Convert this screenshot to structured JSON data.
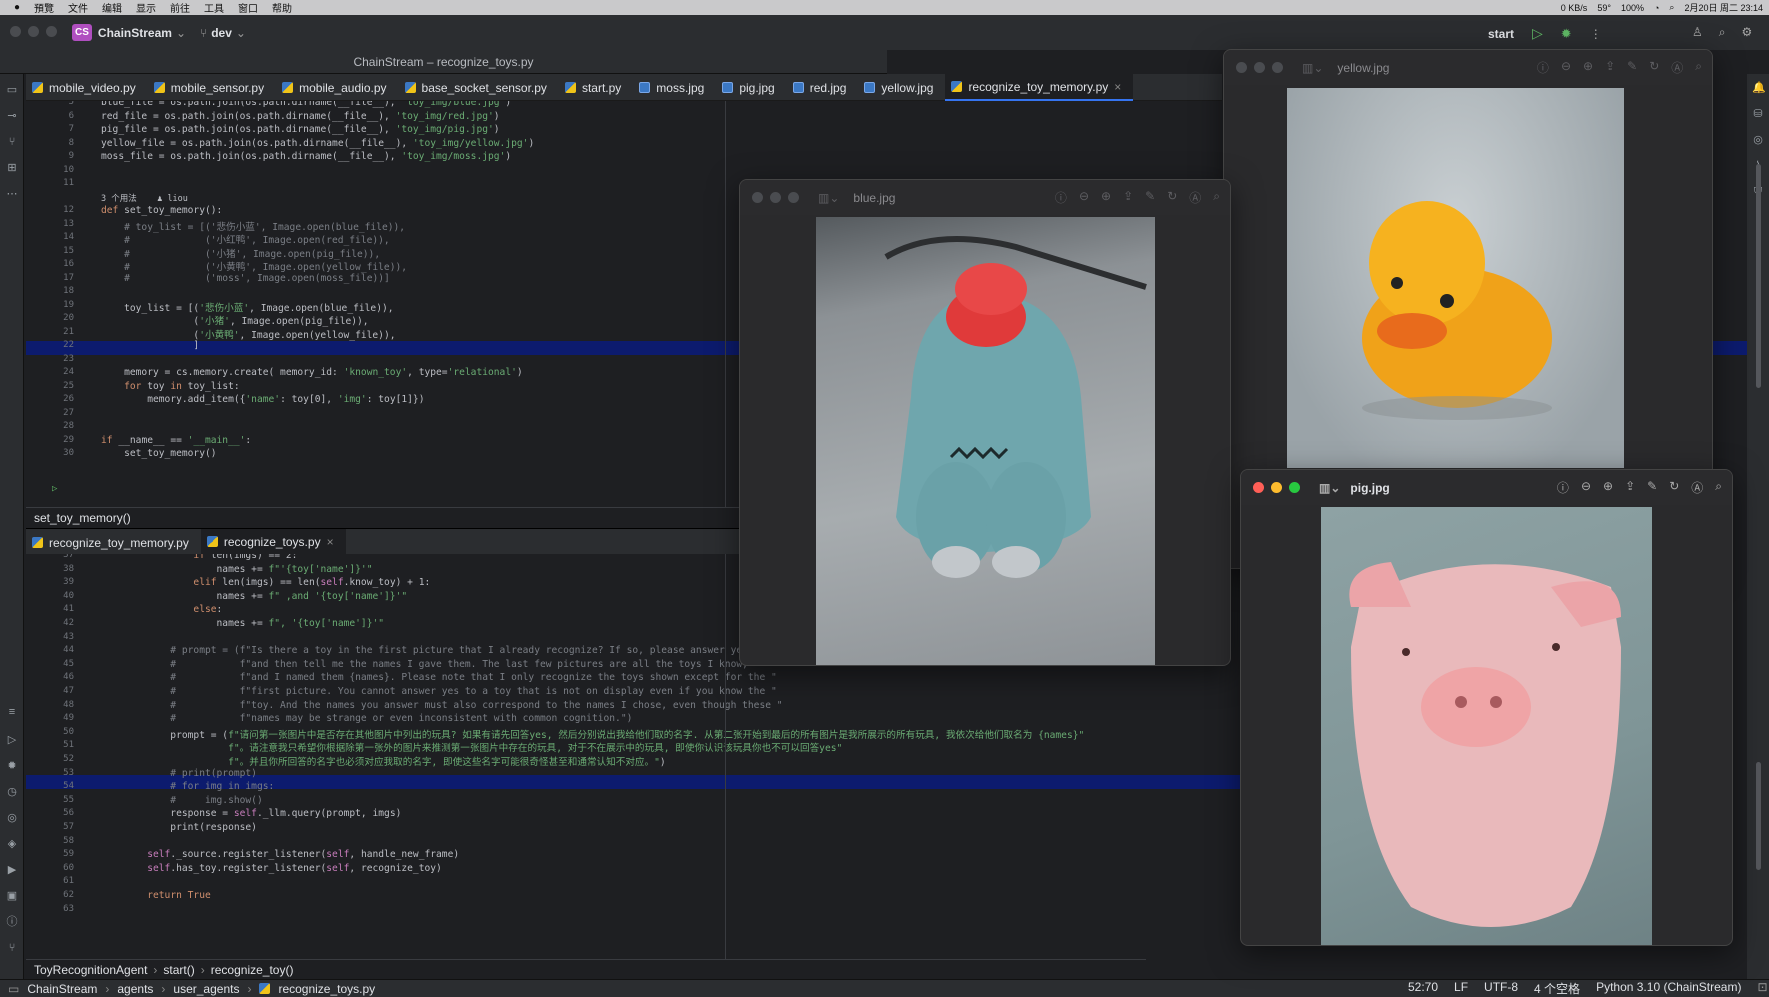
{
  "menubar": {
    "items": [
      "預覽",
      "文件",
      "编辑",
      "显示",
      "前往",
      "工具",
      "窗口",
      "帮助"
    ],
    "status": "100%",
    "temp": "59°",
    "datetime": "2月20日 周二 23:14",
    "net": "0 KB/s"
  },
  "toolbar": {
    "project": "ChainStream",
    "project_badge": "CS",
    "branch": "dev",
    "run_config": "start"
  },
  "window_title": "ChainStream – recognize_toys.py",
  "tabs": [
    "mobile_video.py",
    "mobile_sensor.py",
    "mobile_audio.py",
    "base_socket_sensor.py",
    "start.py",
    "moss.jpg",
    "pig.jpg",
    "red.jpg",
    "yellow.jpg",
    "recognize_toy_memory.py"
  ],
  "tab_types": [
    "py",
    "py",
    "py",
    "py",
    "py",
    "img",
    "img",
    "img",
    "img",
    "py"
  ],
  "editor1": {
    "line_numbers": [
      "5",
      "6",
      "7",
      "8",
      "9",
      "10",
      "11",
      "",
      "12",
      "13",
      "14",
      "15",
      "16",
      "17",
      "18",
      "19",
      "20",
      "21",
      "22",
      "23",
      "24",
      "25",
      "26",
      "27",
      "28",
      "29",
      "30"
    ],
    "usage_hint": "3 个用法    ♟ liou",
    "lines": [
      "blue_file = os.path.join(os.path.dirname(__file__), 'toy_img/blue.jpg')",
      "red_file = os.path.join(os.path.dirname(__file__), 'toy_img/red.jpg')",
      "pig_file = os.path.join(os.path.dirname(__file__), 'toy_img/pig.jpg')",
      "yellow_file = os.path.join(os.path.dirname(__file__), 'toy_img/yellow.jpg')",
      "moss_file = os.path.join(os.path.dirname(__file__), 'toy_img/moss.jpg')",
      "",
      "",
      "",
      "def set_toy_memory():",
      "    # toy_list = [('悲伤小蓝', Image.open(blue_file)),",
      "    #             ('小红鸭', Image.open(red_file)),",
      "    #             ('小猪', Image.open(pig_file)),",
      "    #             ('小黄鸭', Image.open(yellow_file)),",
      "    #             ('moss', Image.open(moss_file))]",
      "",
      "    toy_list = [('悲伤小蓝', Image.open(blue_file)),",
      "                ('小猪', Image.open(pig_file)),",
      "                ('小黄鸭', Image.open(yellow_file)),",
      "                ]",
      "",
      "    memory = cs.memory.create( memory_id: 'known_toy', type='relational')",
      "    for toy in toy_list:",
      "        memory.add_item({'name': toy[0], 'img': toy[1]})",
      "",
      "",
      "if __name__ == '__main__':",
      "    set_toy_memory()"
    ]
  },
  "crumb1": "set_toy_memory()",
  "tabs2": [
    "recognize_toy_memory.py",
    "recognize_toys.py"
  ],
  "editor2": {
    "line_numbers": [
      "37",
      "38",
      "39",
      "40",
      "41",
      "42",
      "43",
      "44",
      "45",
      "46",
      "47",
      "48",
      "49",
      "50",
      "51",
      "52",
      "53",
      "54",
      "55",
      "56",
      "57",
      "58",
      "59",
      "60",
      "61",
      "62",
      "63"
    ],
    "lines": [
      "                if len(imgs) == 2:",
      "                    names += f\"'{toy['name']}'\"",
      "                elif len(imgs) == len(self.know_toy) + 1:",
      "                    names += f\" ,and '{toy['name']}'\"",
      "                else:",
      "                    names += f\", '{toy['name']}'\"",
      "",
      "            # prompt = (f\"Is there a toy in the first picture that I already recognize? If so, please answer yes first, \"",
      "            #           f\"and then tell me the names I gave them. The last few pictures are all the toys I know, \"",
      "            #           f\"and I named them {names}. Please note that I only recognize the toys shown except for the \"",
      "            #           f\"first picture. You cannot answer yes to a toy that is not on display even if you know the \"",
      "            #           f\"toy. And the names you answer must also correspond to the names I chose, even though these \"",
      "            #           f\"names may be strange or even inconsistent with common cognition.\")",
      "            prompt = (f\"请问第一张图片中是否存在其他图片中列出的玩具? 如果有请先回答yes, 然后分别说出我给他们取的名字. 从第二张开始到最后的所有图片是我所展示的所有玩具, 我依次给他们取名为 {names}\"",
      "                      f\"。请注意我只希望你根据除第一张外的图片来推测第一张图片中存在的玩具, 对于不在展示中的玩具, 即使你认识该玩具你也不可以回答yes\"",
      "                      f\"。并且你所回答的名字也必须对应我取的名字, 即使这些名字可能很奇怪甚至和通常认知不对应。\")",
      "            # print(prompt)",
      "            # for img in imgs:",
      "            #     img.show()",
      "            response = self._llm.query(prompt, imgs)",
      "            print(response)",
      "",
      "        self._source.register_listener(self, handle_new_frame)",
      "        self.has_toy.register_listener(self, recognize_toy)",
      "",
      "        return True",
      ""
    ]
  },
  "crumb2": [
    "ToyRecognitionAgent",
    "start()",
    "recognize_toy()"
  ],
  "statusbar": {
    "path": [
      "ChainStream",
      "agents",
      "user_agents",
      "recognize_toys.py"
    ],
    "position": "52:70",
    "line_sep": "LF",
    "encoding": "UTF-8",
    "indent": "4 个空格",
    "interpreter": "Python 3.10 (ChainStream)"
  },
  "preview_windows": [
    {
      "title": "blue.jpg"
    },
    {
      "title": "yellow.jpg"
    },
    {
      "title": "pig.jpg"
    }
  ]
}
